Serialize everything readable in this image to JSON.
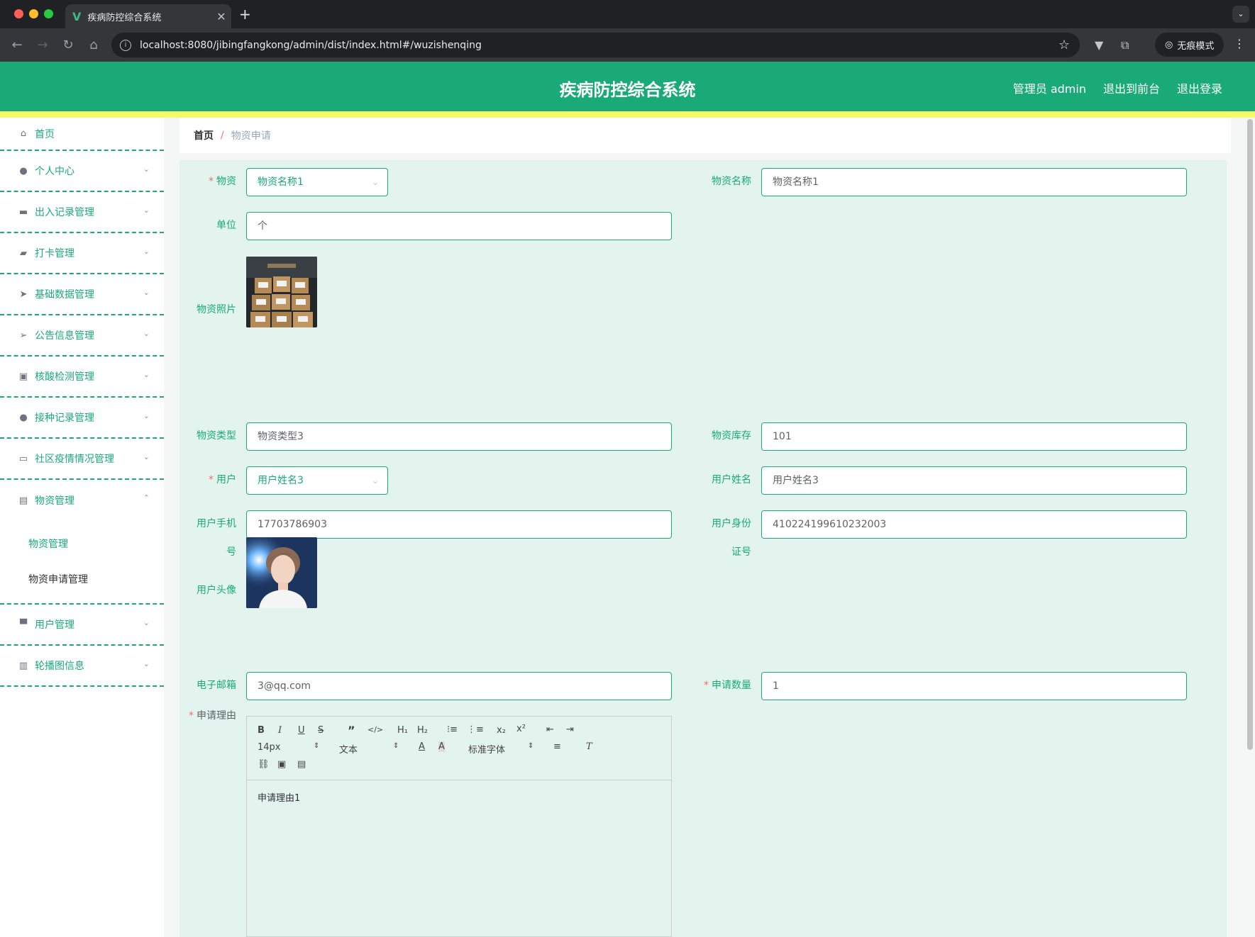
{
  "browser": {
    "tab_title": "疾病防控综合系统",
    "url": "localhost:8080/jibingfangkong/admin/dist/index.html#/wuzishenqing",
    "incognito_label": "无痕模式"
  },
  "header": {
    "title": "疾病防控综合系统",
    "admin_label": "管理员 admin",
    "to_front_label": "退出到前台",
    "logout_label": "退出登录"
  },
  "sidebar": {
    "items": [
      {
        "label": "首页",
        "icon": "home-icon"
      },
      {
        "label": "个人中心",
        "icon": "user-icon"
      },
      {
        "label": "出入记录管理",
        "icon": "printer-icon"
      },
      {
        "label": "打卡管理",
        "icon": "wallet-icon"
      },
      {
        "label": "基础数据管理",
        "icon": "paper-plane-icon"
      },
      {
        "label": "公告信息管理",
        "icon": "send-icon"
      },
      {
        "label": "核酸检测管理",
        "icon": "briefcase-icon"
      },
      {
        "label": "接种记录管理",
        "icon": "user-icon"
      },
      {
        "label": "社区疫情情况管理",
        "icon": "chat-icon"
      },
      {
        "label": "物资管理",
        "icon": "message-icon"
      },
      {
        "label": "用户管理",
        "icon": "board-icon"
      },
      {
        "label": "轮播图信息",
        "icon": "bar-chart-icon"
      }
    ],
    "submenu": [
      {
        "label": "物资管理"
      },
      {
        "label": "物资申请管理"
      }
    ]
  },
  "breadcrumb": {
    "home": "首页",
    "separator": "/",
    "current": "物资申请"
  },
  "form": {
    "wuzi_label": "物资",
    "wuzi_value": "物资名称1",
    "wuzi_name_label": "物资名称",
    "wuzi_name_value": "物资名称1",
    "unit_label": "单位",
    "unit_value": "个",
    "photo_label": "物资照片",
    "type_label": "物资类型",
    "type_value": "物资类型3",
    "stock_label": "物资库存",
    "stock_value": "101",
    "user_label": "用户",
    "user_value": "用户姓名3",
    "user_name_label": "用户姓名",
    "user_name_value": "用户姓名3",
    "phone_label_1": "用户手机",
    "phone_label_2": "号",
    "phone_value": "17703786903",
    "idcard_label_1": "用户身份",
    "idcard_label_2": "证号",
    "idcard_value": "410224199610232003",
    "avatar_label": "用户头像",
    "email_label": "电子邮箱",
    "email_value": "3@qq.com",
    "qty_label": "申请数量",
    "qty_value": "1",
    "reason_label": "申请理由",
    "reason_value": "申请理由1",
    "required_mark": "*"
  },
  "editor_toolbar": {
    "size": "14px",
    "header": "文本",
    "font": "标准字体"
  },
  "colors": {
    "primary": "#1aaa78",
    "panel": "#e3f4ef",
    "accent_strip": "#f6f96a"
  }
}
